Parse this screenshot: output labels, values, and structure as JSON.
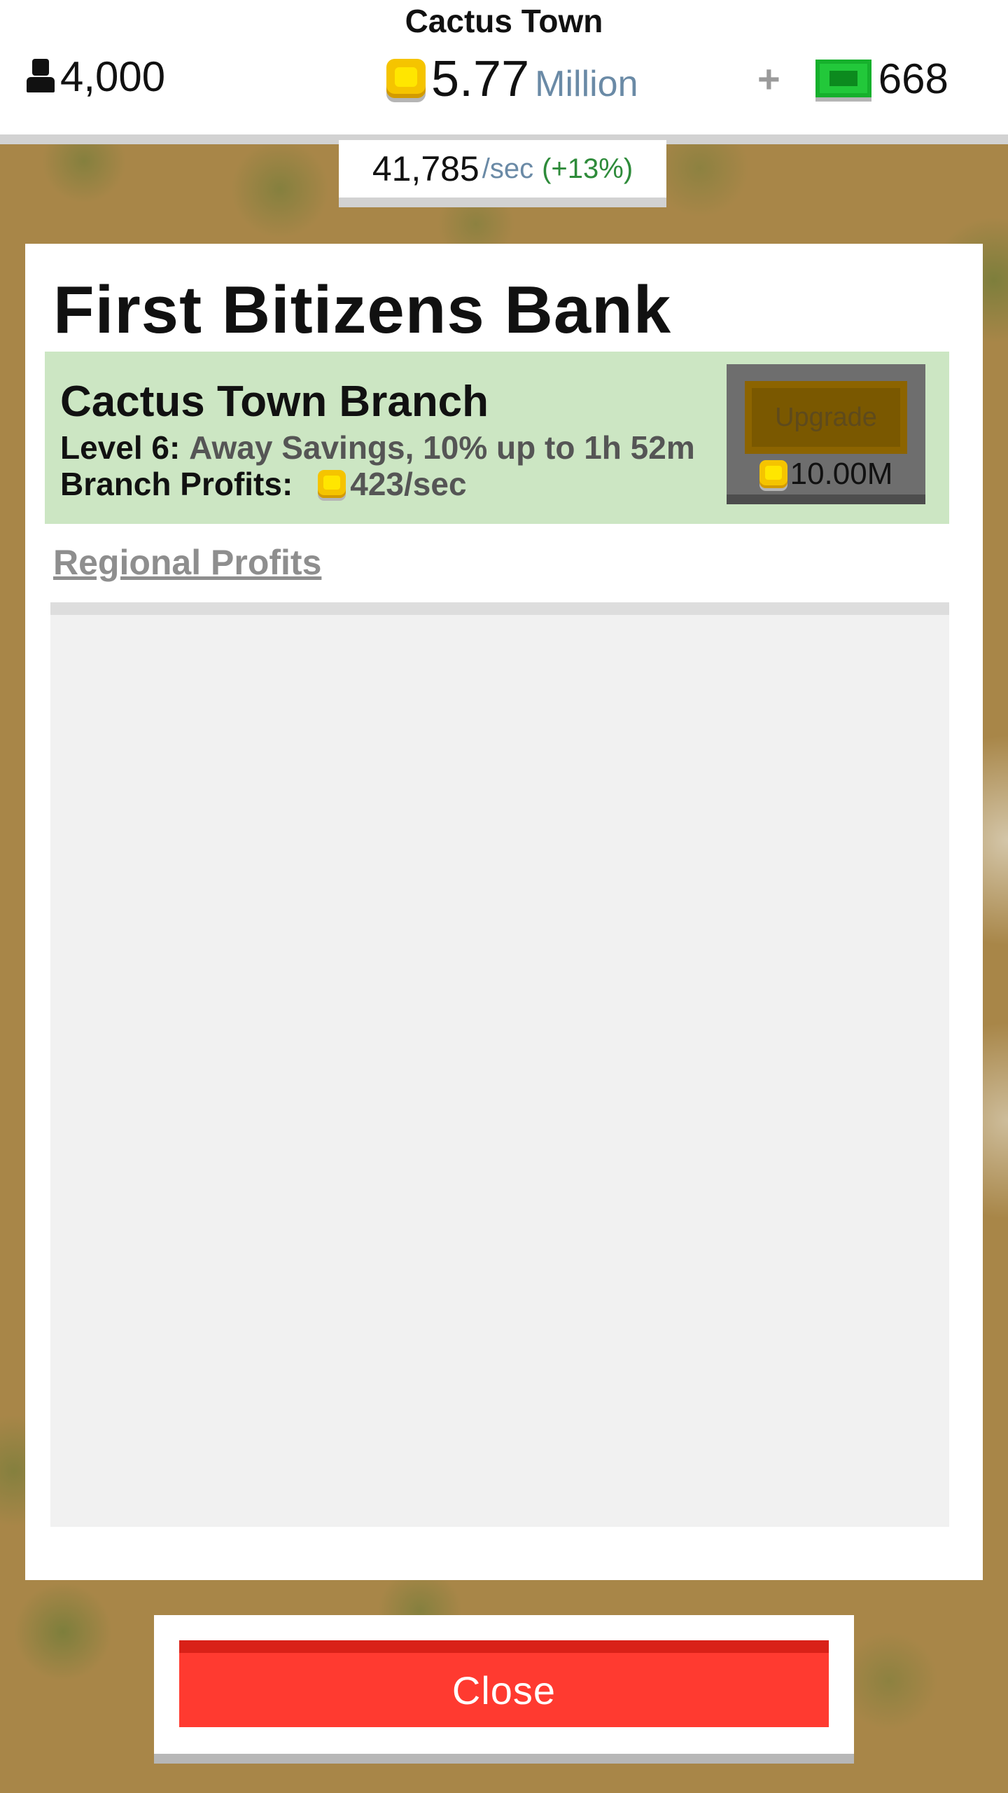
{
  "header": {
    "town_name": "Cactus Town",
    "population": "4,000",
    "coins_value": "5.77",
    "coins_unit": "Million",
    "plus_label": "+",
    "bux_value": "668",
    "rate_value": "41,785",
    "rate_unit": "/sec",
    "rate_bonus": "(+13%)"
  },
  "panel": {
    "title": "First Bitizens Bank",
    "branch": {
      "name": "Cactus Town Branch",
      "level_label": "Level 6:",
      "level_desc": "Away Savings, 10% up to 1h 52m",
      "profits_label": "Branch Profits:",
      "profits_value": "423/sec",
      "upgrade_label": "Upgrade",
      "upgrade_cost": "10.00M"
    },
    "regional_link": "Regional Profits"
  },
  "footer": {
    "close_label": "Close"
  },
  "colors": {
    "coin": "#f5c400",
    "bux": "#22c83a",
    "branch_bg": "#cce6c3",
    "close_red": "#ff3a30",
    "upgrade_disabled": "#7a5800"
  },
  "icons": {
    "population": "person-icon",
    "coins": "coin-icon",
    "bux": "cash-icon",
    "plus": "plus-icon"
  }
}
